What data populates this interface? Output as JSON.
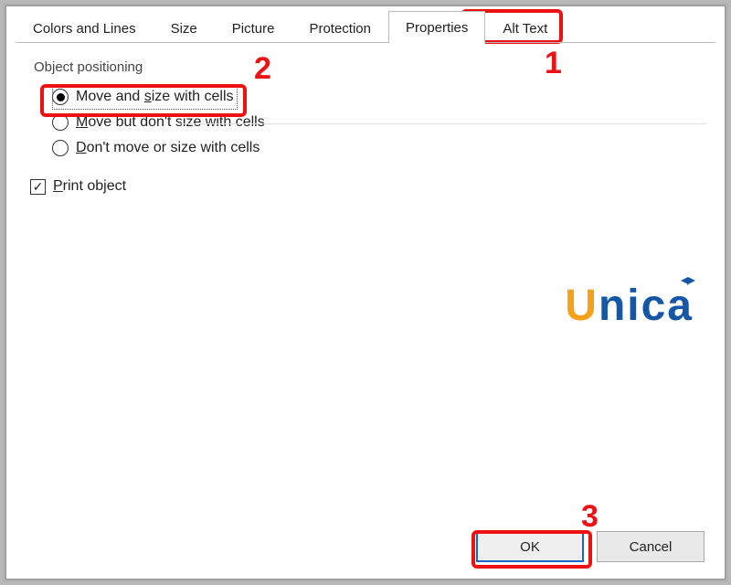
{
  "tabs": {
    "colors": "Colors and Lines",
    "size": "Size",
    "picture": "Picture",
    "protection": "Protection",
    "properties": "Properties",
    "alttext": "Alt Text",
    "active": "properties"
  },
  "group": {
    "heading": "Object positioning"
  },
  "options": {
    "move_size": {
      "pre": "Move and ",
      "uchar": "s",
      "post": "ize with cells",
      "selected": true
    },
    "move_nosize": {
      "uchar": "M",
      "post": "ove but don't size with cells"
    },
    "dont_move": {
      "uchar": "D",
      "post": "on't move or size with cells"
    }
  },
  "print": {
    "uchar": "P",
    "post": "rint object",
    "checked": true
  },
  "buttons": {
    "ok": "OK",
    "cancel": "Cancel"
  },
  "callouts": {
    "n1": "1",
    "n2": "2",
    "n3": "3"
  },
  "watermark": {
    "u": "U",
    "rest": "nica"
  }
}
